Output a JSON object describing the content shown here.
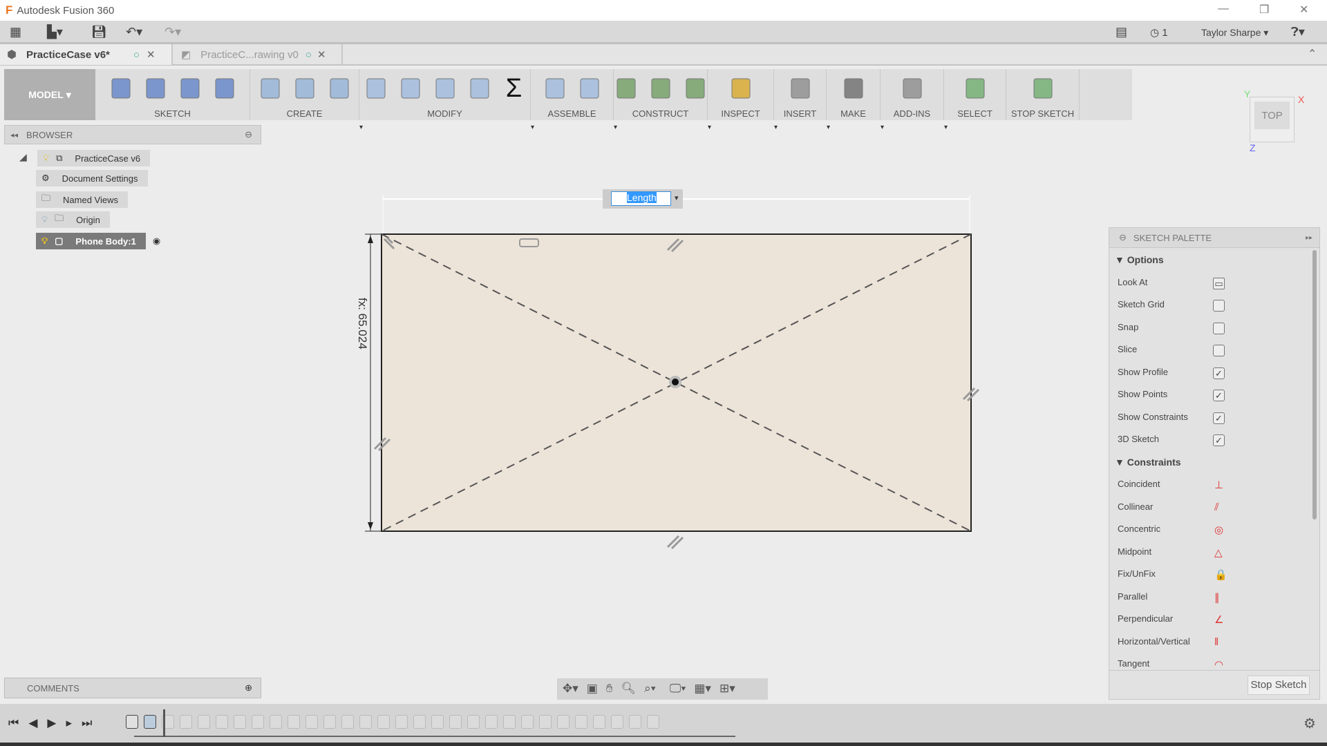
{
  "app": {
    "title": "Autodesk Fusion 360",
    "user": "Taylor Sharpe",
    "jobs_count": "1"
  },
  "tabs": [
    {
      "label": "PracticeCase v6*",
      "active": true
    },
    {
      "label": "PracticeC...rawing v0",
      "active": false
    }
  ],
  "toolbar": {
    "workspace": "MODEL",
    "groups": [
      {
        "label": "SKETCH",
        "icons": [
          "create-sketch-icon",
          "line-icon",
          "rectangle-icon",
          "arc-icon"
        ]
      },
      {
        "label": "CREATE",
        "icons": [
          "extrude-icon",
          "revolve-icon",
          "sweep-icon"
        ]
      },
      {
        "label": "MODIFY",
        "icons": [
          "press-pull-icon",
          "fillet-icon",
          "chamfer-icon",
          "combine-icon",
          "sigma-icon"
        ]
      },
      {
        "label": "ASSEMBLE",
        "icons": [
          "new-component-icon",
          "joint-icon"
        ]
      },
      {
        "label": "CONSTRUCT",
        "icons": [
          "offset-plane-icon",
          "midplane-icon",
          "tangent-plane-icon"
        ]
      },
      {
        "label": "INSPECT",
        "icons": [
          "measure-icon"
        ]
      },
      {
        "label": "INSERT",
        "icons": [
          "insert-image-icon"
        ]
      },
      {
        "label": "MAKE",
        "icons": [
          "3d-print-icon"
        ]
      },
      {
        "label": "ADD-INS",
        "icons": [
          "scripts-icon"
        ]
      },
      {
        "label": "SELECT",
        "icons": [
          "select-icon"
        ]
      },
      {
        "label": "STOP SKETCH",
        "icons": [
          "stop-sketch-icon"
        ]
      }
    ]
  },
  "browser": {
    "title": "BROWSER",
    "items": [
      {
        "label": "PracticeCase v6",
        "icon": "component-icon"
      },
      {
        "label": "Document Settings",
        "icon": "gear-icon"
      },
      {
        "label": "Named Views",
        "icon": "folder-icon"
      },
      {
        "label": "Origin",
        "icon": "folder-icon"
      },
      {
        "label": "Phone Body:1",
        "icon": "body-icon"
      }
    ]
  },
  "comments": {
    "title": "COMMENTS"
  },
  "canvas": {
    "length_input": "Length",
    "dimension_label": "fx: 65.024",
    "viewcube": "TOP",
    "axes": {
      "x": "X",
      "y": "Y",
      "z": "Z"
    },
    "sketch_fill": "#ede4d9"
  },
  "palette": {
    "title": "SKETCH PALETTE",
    "options_title": "Options",
    "options": [
      {
        "label": "Look At",
        "type": "button"
      },
      {
        "label": "Sketch Grid",
        "checked": false
      },
      {
        "label": "Snap",
        "checked": false
      },
      {
        "label": "Slice",
        "checked": false
      },
      {
        "label": "Show Profile",
        "checked": true
      },
      {
        "label": "Show Points",
        "checked": true
      },
      {
        "label": "Show Constraints",
        "checked": true
      },
      {
        "label": "3D Sketch",
        "checked": true
      }
    ],
    "constraints_title": "Constraints",
    "constraints": [
      {
        "label": "Coincident",
        "glyph": "⊥"
      },
      {
        "label": "Collinear",
        "glyph": "⫽"
      },
      {
        "label": "Concentric",
        "glyph": "◎"
      },
      {
        "label": "Midpoint",
        "glyph": "△"
      },
      {
        "label": "Fix/UnFix",
        "glyph": "🔒"
      },
      {
        "label": "Parallel",
        "glyph": "∥"
      },
      {
        "label": "Perpendicular",
        "glyph": "∠"
      },
      {
        "label": "Horizontal/Vertical",
        "glyph": "‖"
      },
      {
        "label": "Tangent",
        "glyph": "◠"
      }
    ],
    "stop_button": "Stop Sketch"
  }
}
